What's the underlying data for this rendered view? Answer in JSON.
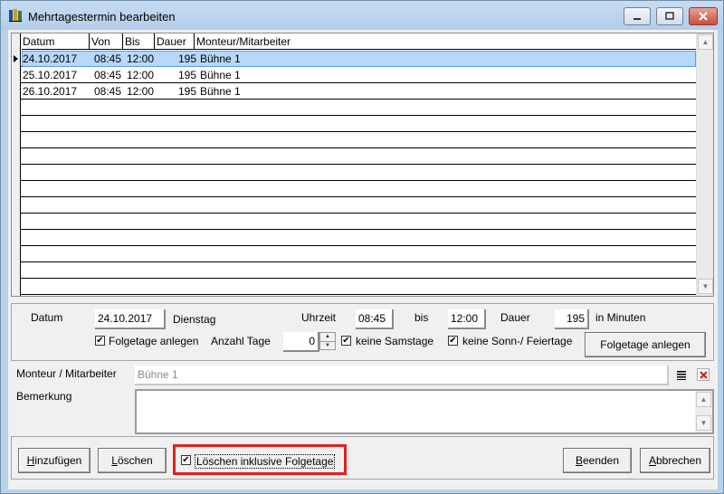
{
  "window": {
    "title": "Mehrtagestermin bearbeiten"
  },
  "grid": {
    "columns": [
      "Datum",
      "Von",
      "Bis",
      "Dauer",
      "Monteur/Mitarbeiter"
    ],
    "rows": [
      {
        "datum": "24.10.2017",
        "von": "08:45",
        "bis": "12:00",
        "dauer": "195",
        "monteur": "Bühne 1",
        "selected": true
      },
      {
        "datum": "25.10.2017",
        "von": "08:45",
        "bis": "12:00",
        "dauer": "195",
        "monteur": "Bühne 1"
      },
      {
        "datum": "26.10.2017",
        "von": "08:45",
        "bis": "12:00",
        "dauer": "195",
        "monteur": "Bühne 1"
      }
    ]
  },
  "form": {
    "datum_label": "Datum",
    "datum_value": "24.10.2017",
    "weekday": "Dienstag",
    "uhrzeit_label": "Uhrzeit",
    "uhrzeit_value": "08:45",
    "bis_label": "bis",
    "bis_value": "12:00",
    "dauer_label": "Dauer",
    "dauer_value": "195",
    "minutes_label": "in Minuten",
    "folgetage_checkbox_label": "Folgetage anlegen",
    "anzahl_tage_label": "Anzahl Tage",
    "anzahl_tage_value": "0",
    "keine_samstage_label": "keine Samstage",
    "keine_sonn_label": "keine Sonn-/ Feiertage",
    "folgetage_button": "Folgetage anlegen",
    "monteur_label": "Monteur / Mitarbeiter",
    "monteur_value": "Bühne 1",
    "bemerkung_label": "Bemerkung",
    "bemerkung_value": ""
  },
  "buttons": {
    "hinzufuegen_u": "H",
    "hinzufuegen_rest": "inzufügen",
    "loeschen_u": "L",
    "loeschen_rest": "öschen",
    "loeschen_folgetage_label": "Löschen inklusive Folgetage",
    "beenden_u": "B",
    "beenden_rest": "eenden",
    "abbrechen_u": "A",
    "abbrechen_rest": "bbrechen"
  },
  "colors": {
    "highlight": "#e02020",
    "selection": "#b7d8fa"
  }
}
